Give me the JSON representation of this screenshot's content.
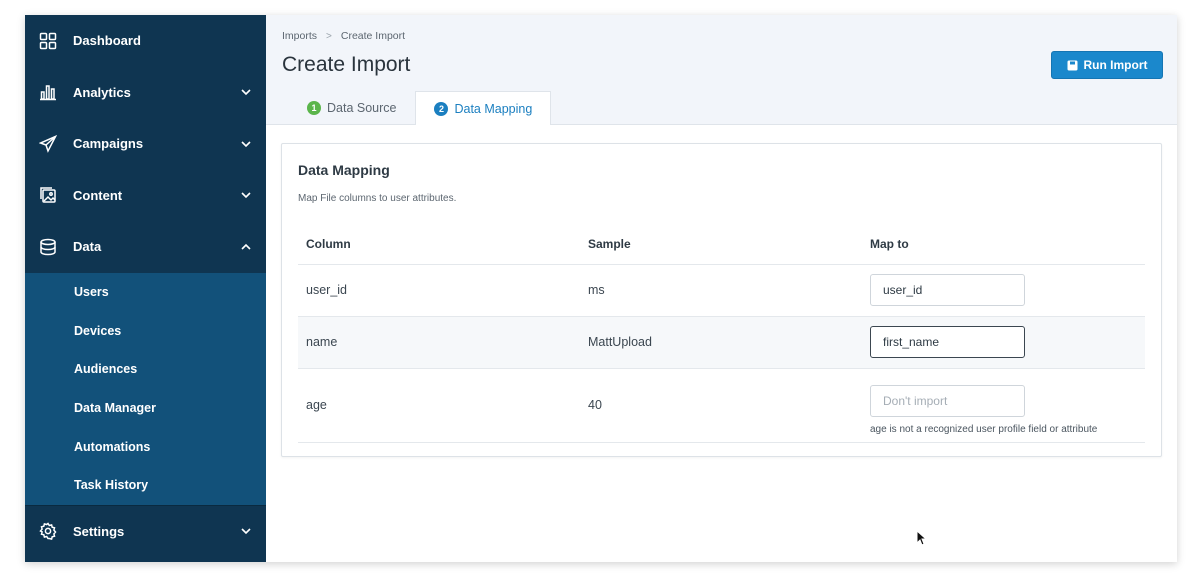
{
  "sidebar": {
    "items": [
      {
        "label": "Dashboard",
        "icon": "dashboard-icon"
      },
      {
        "label": "Analytics",
        "icon": "analytics-icon"
      },
      {
        "label": "Campaigns",
        "icon": "campaigns-icon"
      },
      {
        "label": "Content",
        "icon": "content-icon"
      },
      {
        "label": "Data",
        "icon": "data-icon"
      }
    ],
    "data_subitems": [
      "Users",
      "Devices",
      "Audiences",
      "Data Manager",
      "Automations",
      "Task History"
    ],
    "settings_label": "Settings"
  },
  "header": {
    "breadcrumb": [
      "Imports",
      "Create Import"
    ],
    "title": "Create Import",
    "run_button_label": "Run Import",
    "tabs": [
      {
        "num": "1",
        "label": "Data Source"
      },
      {
        "num": "2",
        "label": "Data Mapping"
      }
    ]
  },
  "mapping": {
    "title": "Data Mapping",
    "subtitle": "Map File columns to user attributes.",
    "columns": [
      "Column",
      "Sample",
      "Map to"
    ],
    "rows": [
      {
        "column": "user_id",
        "sample": "ms",
        "map_to": "user_id",
        "placeholder": ""
      },
      {
        "column": "name",
        "sample": "MattUpload",
        "map_to": "first_name",
        "placeholder": ""
      },
      {
        "column": "age",
        "sample": "40",
        "map_to": "",
        "placeholder": "Don't import",
        "hint": "age is not a recognized user profile field or attribute"
      }
    ]
  },
  "colors": {
    "sidebar_bg": "#0f3551",
    "subnav_bg": "#12517a",
    "accent": "#1b88cc",
    "step_done": "#5bb54b"
  }
}
